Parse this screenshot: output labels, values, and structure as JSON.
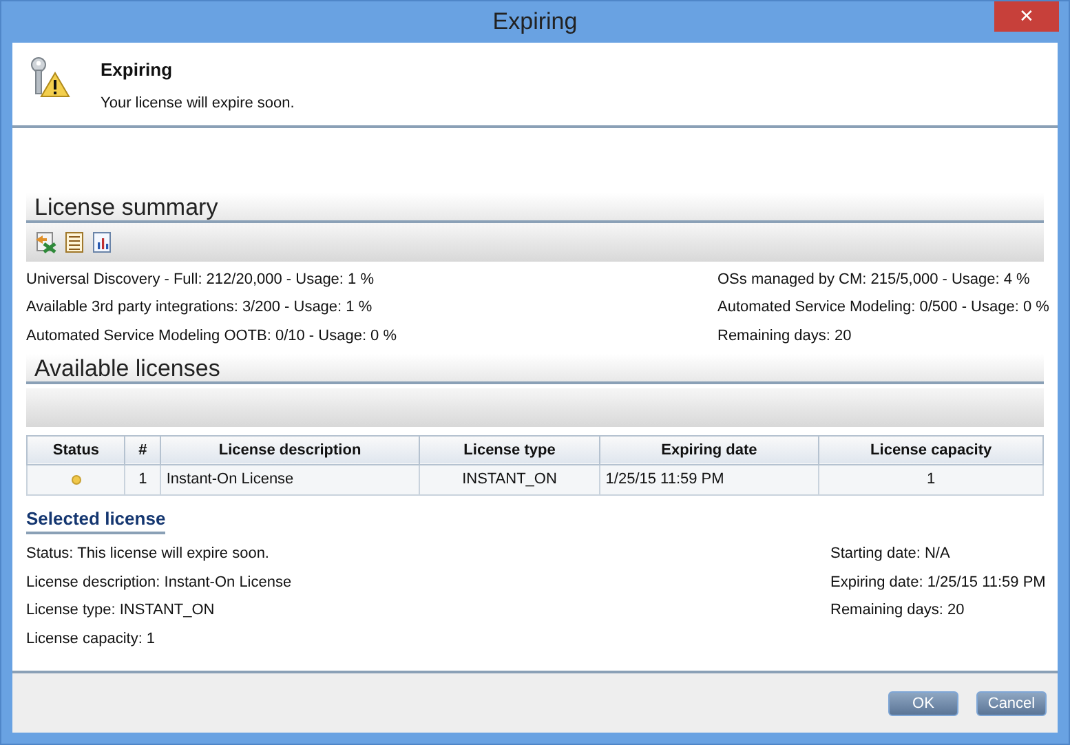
{
  "window": {
    "title": "Expiring",
    "close": "✕"
  },
  "header": {
    "title": "Expiring",
    "message": "Your license will expire soon."
  },
  "license_summary": {
    "title": "License summary",
    "left": [
      "Universal Discovery - Full: 212/20,000 - Usage: 1 %",
      "Available 3rd party integrations: 3/200 - Usage: 1 %",
      "Automated Service Modeling OOTB: 0/10 - Usage: 0 %"
    ],
    "right": [
      "OSs managed by CM: 215/5,000 - Usage: 4 %",
      "Automated Service Modeling: 0/500 - Usage: 0 %",
      "Remaining days: 20"
    ]
  },
  "available_licenses": {
    "title": "Available licenses",
    "table": {
      "columns": [
        "Status",
        "#",
        "License description",
        "License type",
        "Expiring date",
        "License capacity"
      ],
      "rows": [
        {
          "number": "1",
          "description": "Instant-On License",
          "type": "INSTANT_ON",
          "expiring_date": "1/25/15 11:59 PM",
          "capacity": "1"
        }
      ]
    }
  },
  "selected_license": {
    "title": "Selected license",
    "left": [
      "Status: This license will expire soon.",
      "License description: Instant-On License",
      "License type: INSTANT_ON",
      "License capacity: 1"
    ],
    "right": [
      "Starting date: N/A",
      "Expiring date: 1/25/15 11:59 PM",
      "Remaining days: 20"
    ]
  },
  "buttons": [
    "OK",
    "Cancel"
  ]
}
